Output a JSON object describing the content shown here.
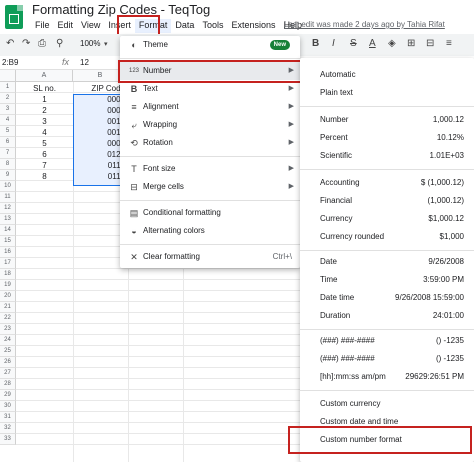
{
  "header": {
    "title": "Formatting Zip Codes - TeqTog",
    "last_edit": "Last edit was made 2 days ago by Tahia Rifat",
    "menus": [
      "File",
      "Edit",
      "View",
      "Insert",
      "Format",
      "Data",
      "Tools",
      "Extensions",
      "Help"
    ]
  },
  "toolbar": {
    "zoom": "100%",
    "bold": "B"
  },
  "formula_bar": {
    "cell_ref": "2:B9",
    "fx": "fx",
    "value": "12"
  },
  "grid": {
    "columns": [
      "A",
      "B"
    ],
    "rows": [
      "1",
      "2",
      "3",
      "4",
      "5",
      "6",
      "7",
      "8",
      "9",
      "10",
      "11",
      "12",
      "13",
      "14",
      "15",
      "16",
      "17",
      "18",
      "19",
      "20",
      "21",
      "22",
      "23",
      "24",
      "25",
      "26",
      "27",
      "28",
      "29",
      "30",
      "31",
      "32",
      "33"
    ],
    "headers": [
      "SL no.",
      "ZIP Code"
    ],
    "data": [
      [
        "1",
        "0001"
      ],
      [
        "2",
        "0001"
      ],
      [
        "3",
        "0012"
      ],
      [
        "4",
        "0012"
      ],
      [
        "5",
        "0000"
      ],
      [
        "6",
        "0123"
      ],
      [
        "7",
        "0112"
      ],
      [
        "8",
        "0112"
      ]
    ]
  },
  "format_menu": {
    "theme": "Theme",
    "new_badge": "New",
    "number": "Number",
    "text": "Text",
    "alignment": "Alignment",
    "wrapping": "Wrapping",
    "rotation": "Rotation",
    "font_size": "Font size",
    "merge_cells": "Merge cells",
    "conditional": "Conditional formatting",
    "alternating": "Alternating colors",
    "clear": "Clear formatting",
    "clear_shortcut": "Ctrl+\\"
  },
  "number_submenu": {
    "automatic": "Automatic",
    "plain_text": "Plain text",
    "items1": [
      {
        "label": "Number",
        "example": "1,000.12"
      },
      {
        "label": "Percent",
        "example": "10.12%"
      },
      {
        "label": "Scientific",
        "example": "1.01E+03"
      }
    ],
    "items2": [
      {
        "label": "Accounting",
        "example": "$ (1,000.12)"
      },
      {
        "label": "Financial",
        "example": "(1,000.12)"
      },
      {
        "label": "Currency",
        "example": "$1,000.12"
      },
      {
        "label": "Currency rounded",
        "example": "$1,000"
      }
    ],
    "items3": [
      {
        "label": "Date",
        "example": "9/26/2008"
      },
      {
        "label": "Time",
        "example": "3:59:00 PM"
      },
      {
        "label": "Date time",
        "example": "9/26/2008 15:59:00"
      },
      {
        "label": "Duration",
        "example": "24:01:00"
      }
    ],
    "items4": [
      {
        "label": "(###) ###-####",
        "example": "() -1235"
      },
      {
        "label": "(###) ###-####",
        "example": "() -1235"
      },
      {
        "label": "[hh]:mm:ss am/pm",
        "example": "29629:26:51 PM"
      }
    ],
    "custom_currency": "Custom currency",
    "custom_date": "Custom date and time",
    "custom_number": "Custom number format"
  },
  "icons": {
    "theme": "palette-icon",
    "number": "123-icon",
    "text": "bold-icon",
    "alignment": "align-left-icon",
    "wrapping": "wrap-icon",
    "rotation": "rotate-icon",
    "font_size": "font-size-icon",
    "merge": "merge-icon",
    "conditional": "conditional-format-icon",
    "alternating": "alternating-colors-icon",
    "clear": "clear-format-icon"
  },
  "colors": {
    "accent": "#1a73e8",
    "highlight_box": "#c5221f",
    "badge": "#188038"
  }
}
